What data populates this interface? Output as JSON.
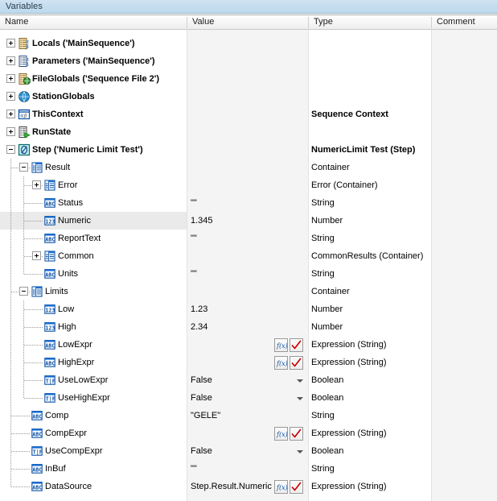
{
  "window": {
    "title": "Variables"
  },
  "columns": [
    {
      "key": "name",
      "label": "Name"
    },
    {
      "key": "value",
      "label": "Value"
    },
    {
      "key": "type",
      "label": "Type"
    },
    {
      "key": "comment",
      "label": "Comment"
    }
  ],
  "tree": {
    "selected_row": "Numeric",
    "rows": [
      {
        "name": "Locals ('MainSequence')",
        "value": "",
        "type": "",
        "icon": "locals-icon",
        "depth": 0,
        "expander": "plus",
        "bold": true
      },
      {
        "name": "Parameters ('MainSequence')",
        "value": "",
        "type": "",
        "icon": "parameters-icon",
        "depth": 0,
        "expander": "plus",
        "bold": true
      },
      {
        "name": "FileGlobals ('Sequence File 2')",
        "value": "",
        "type": "",
        "icon": "fileglobals-icon",
        "depth": 0,
        "expander": "plus",
        "bold": true
      },
      {
        "name": "StationGlobals",
        "value": "",
        "type": "",
        "icon": "globe-icon",
        "depth": 0,
        "expander": "plus",
        "bold": true
      },
      {
        "name": "ThisContext",
        "value": "",
        "type": "Sequence Context",
        "icon": "context-icon",
        "depth": 0,
        "expander": "plus",
        "bold": true
      },
      {
        "name": "RunState",
        "value": "",
        "type": "",
        "icon": "runstate-icon",
        "depth": 0,
        "expander": "plus",
        "bold": true
      },
      {
        "name": "Step ('Numeric Limit Test')",
        "value": "",
        "type": "NumericLimit Test (Step)",
        "icon": "step-icon",
        "depth": 0,
        "expander": "minus",
        "bold": true
      },
      {
        "name": "Result",
        "value": "",
        "type": "Container",
        "icon": "container-icon",
        "depth": 1,
        "expander": "minus",
        "bold": false
      },
      {
        "name": "Error",
        "value": "",
        "type": "Error (Container)",
        "icon": "container-icon",
        "depth": 2,
        "expander": "plus",
        "bold": false
      },
      {
        "name": "Status",
        "value": "\"\"",
        "type": "String",
        "icon": "string-icon",
        "depth": 2,
        "expander": "none",
        "bold": false
      },
      {
        "name": "Numeric",
        "value": "1.345",
        "type": "Number",
        "icon": "number-icon",
        "depth": 2,
        "expander": "none",
        "bold": false
      },
      {
        "name": "ReportText",
        "value": "\"\"",
        "type": "String",
        "icon": "string-icon",
        "depth": 2,
        "expander": "none",
        "bold": false
      },
      {
        "name": "Common",
        "value": "",
        "type": "CommonResults (Container)",
        "icon": "container-icon",
        "depth": 2,
        "expander": "plus",
        "bold": false
      },
      {
        "name": "Units",
        "value": "\"\"",
        "type": "String",
        "icon": "string-icon",
        "depth": 2,
        "expander": "none",
        "bold": false
      },
      {
        "name": "Limits",
        "value": "",
        "type": "Container",
        "icon": "container-icon",
        "depth": 1,
        "expander": "minus",
        "bold": false
      },
      {
        "name": "Low",
        "value": "1.23",
        "type": "Number",
        "icon": "number-icon",
        "depth": 2,
        "expander": "none",
        "bold": false
      },
      {
        "name": "High",
        "value": "2.34",
        "type": "Number",
        "icon": "number-icon",
        "depth": 2,
        "expander": "none",
        "bold": false
      },
      {
        "name": "LowExpr",
        "value": "",
        "type": "Expression (String)",
        "icon": "string-icon",
        "depth": 2,
        "expander": "none",
        "bold": false,
        "widgets": "fx-check"
      },
      {
        "name": "HighExpr",
        "value": "",
        "type": "Expression (String)",
        "icon": "string-icon",
        "depth": 2,
        "expander": "none",
        "bold": false,
        "widgets": "fx-check"
      },
      {
        "name": "UseLowExpr",
        "value": "False",
        "type": "Boolean",
        "icon": "boolean-icon",
        "depth": 2,
        "expander": "none",
        "bold": false,
        "widgets": "dropdown"
      },
      {
        "name": "UseHighExpr",
        "value": "False",
        "type": "Boolean",
        "icon": "boolean-icon",
        "depth": 2,
        "expander": "none",
        "bold": false,
        "widgets": "dropdown"
      },
      {
        "name": "Comp",
        "value": "\"GELE\"",
        "type": "String",
        "icon": "string-icon",
        "depth": 1,
        "expander": "none",
        "bold": false
      },
      {
        "name": "CompExpr",
        "value": "",
        "type": "Expression (String)",
        "icon": "string-icon",
        "depth": 1,
        "expander": "none",
        "bold": false,
        "widgets": "fx-check"
      },
      {
        "name": "UseCompExpr",
        "value": "False",
        "type": "Boolean",
        "icon": "boolean-icon",
        "depth": 1,
        "expander": "none",
        "bold": false,
        "widgets": "dropdown"
      },
      {
        "name": "InBuf",
        "value": "\"\"",
        "type": "String",
        "icon": "string-icon",
        "depth": 1,
        "expander": "none",
        "bold": false
      },
      {
        "name": "DataSource",
        "value": "Step.Result.Numeric",
        "type": "Expression (String)",
        "icon": "string-icon",
        "depth": 1,
        "expander": "none",
        "bold": false,
        "widgets": "fx-check"
      }
    ]
  },
  "widgets": {
    "fx_label": "f(x)",
    "fx_name": "expression-builder-icon",
    "check_name": "validate-check-icon",
    "dropdown_name": "dropdown-arrow-icon"
  },
  "colors": {
    "titlebar": "#c3dcef",
    "shaded_column": "#f4f4f4",
    "selection": "#eaeaea",
    "icon_blue": "#0b51a5",
    "check_red": "#cc0000",
    "grid_line": "#e2e2e2"
  }
}
